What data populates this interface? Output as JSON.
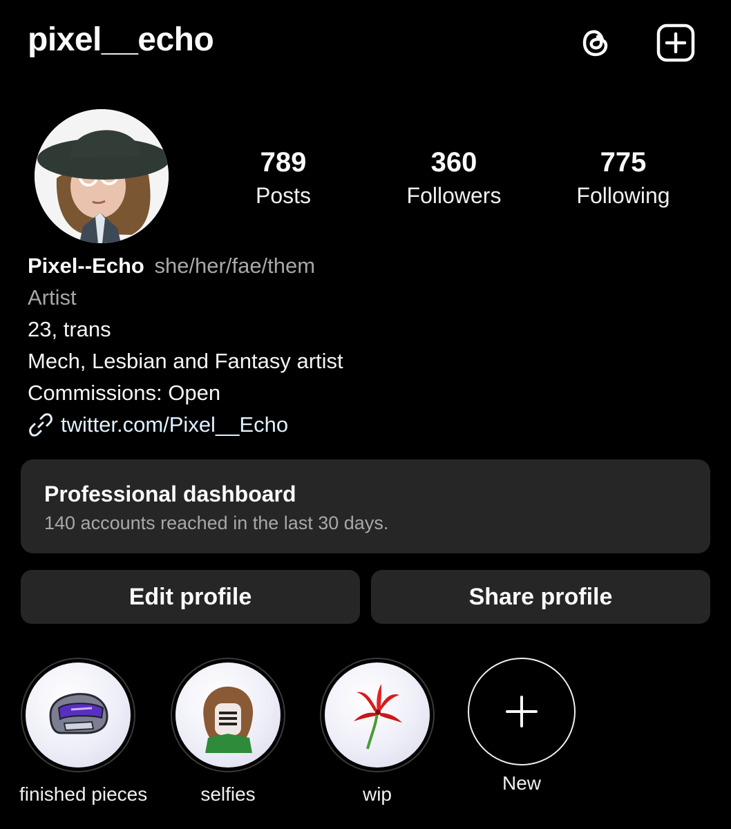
{
  "header": {
    "username": "pixel__echo",
    "icons": [
      "threads-icon",
      "add-post-icon"
    ]
  },
  "stats": {
    "posts": {
      "value": "789",
      "label": "Posts"
    },
    "followers": {
      "value": "360",
      "label": "Followers"
    },
    "following": {
      "value": "775",
      "label": "Following"
    }
  },
  "bio": {
    "name": "Pixel--Echo",
    "pronouns": "she/her/fae/them",
    "category": "Artist",
    "lines": [
      "23, trans",
      "Mech, Lesbian and Fantasy artist",
      "Commissions: Open"
    ],
    "link": "twitter.com/Pixel__Echo"
  },
  "dashboard": {
    "title": "Professional dashboard",
    "subtitle": "140 accounts reached in the last 30 days."
  },
  "buttons": {
    "edit": "Edit profile",
    "share": "Share profile"
  },
  "highlights": [
    {
      "label": "finished pieces",
      "icon": "mech-helmet-icon"
    },
    {
      "label": "selfies",
      "icon": "masked-face-icon"
    },
    {
      "label": "wip",
      "icon": "red-flower-icon"
    },
    {
      "label": "New",
      "icon": "plus-icon"
    }
  ],
  "colors": {
    "background": "#000000",
    "surface": "#262626",
    "text": "#fafafa",
    "muted": "#a8a8a8",
    "link": "#e0f1ff"
  }
}
